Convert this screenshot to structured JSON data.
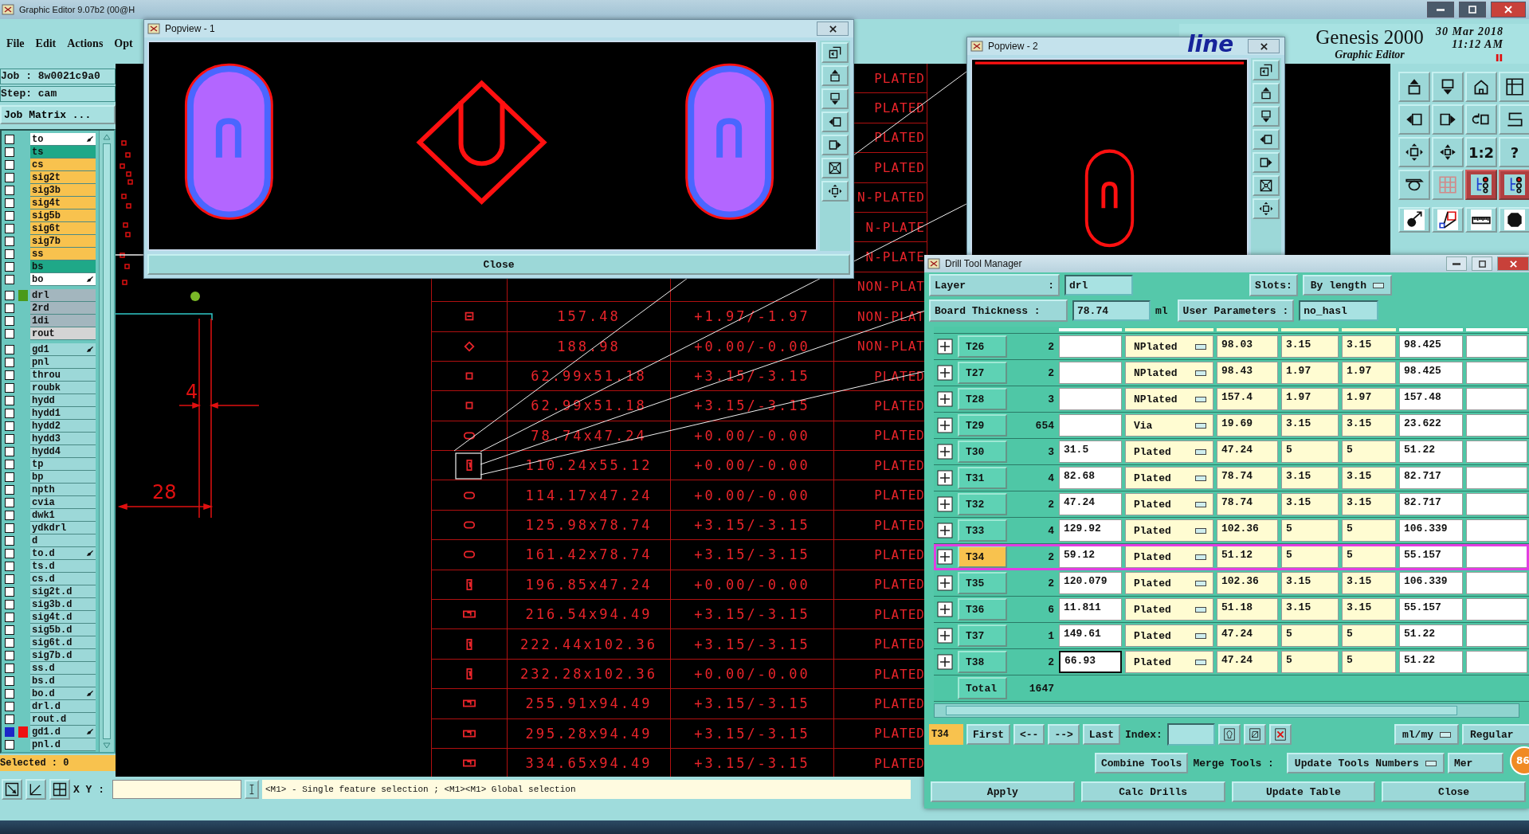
{
  "main_window": {
    "title": "Graphic Editor 9.07b2 (00@H"
  },
  "menu": [
    "File",
    "Edit",
    "Actions",
    "Opt"
  ],
  "header": {
    "logo_fragment": "line",
    "product": "Genesis 2000",
    "subtitle": "Graphic Editor",
    "date": "30 Mar 2018",
    "time": "11:12 AM"
  },
  "job": {
    "job": "Job : 8w0021c9a0",
    "step": "Step: cam",
    "matrix_button": "Job Matrix ..."
  },
  "layer_groups": [
    {
      "layers": [
        {
          "name": "to",
          "color": "#ffffff",
          "pointer": true,
          "selected": false
        },
        {
          "name": "ts",
          "color": "#1fa888",
          "pointer": false,
          "selected": false
        },
        {
          "name": "cs",
          "color": "#f8c24e",
          "pointer": false,
          "selected": false
        },
        {
          "name": "sig2t",
          "color": "#f8c24e",
          "pointer": false,
          "selected": false
        },
        {
          "name": "sig3b",
          "color": "#f8c24e",
          "pointer": false,
          "selected": false
        },
        {
          "name": "sig4t",
          "color": "#f8c24e",
          "pointer": false,
          "selected": false
        },
        {
          "name": "sig5b",
          "color": "#f8c24e",
          "pointer": false,
          "selected": false
        },
        {
          "name": "sig6t",
          "color": "#f8c24e",
          "pointer": false,
          "selected": false
        },
        {
          "name": "sig7b",
          "color": "#f8c24e",
          "pointer": false,
          "selected": false
        },
        {
          "name": "ss",
          "color": "#f8c24e",
          "pointer": false,
          "selected": false
        },
        {
          "name": "bs",
          "color": "#1fa888",
          "pointer": false,
          "selected": false
        },
        {
          "name": "bo",
          "color": "#ffffff",
          "pointer": true,
          "selected": false
        }
      ]
    },
    {
      "layers": [
        {
          "name": "drl",
          "color": "#a3b6be",
          "pointer": false,
          "selected": false,
          "flag": {
            "color": "#4a9a1a"
          }
        },
        {
          "name": "2rd",
          "color": "#a3b6be",
          "pointer": false,
          "selected": false
        },
        {
          "name": "1di",
          "color": "#a3b6be",
          "pointer": false,
          "selected": false
        },
        {
          "name": "rout",
          "color": "#d4d4d4",
          "pointer": false,
          "selected": false
        }
      ]
    },
    {
      "layers": [
        {
          "name": "gd1",
          "color": "#9cd8d8",
          "pointer": true,
          "selected": false
        },
        {
          "name": "pnl",
          "color": "#9cd8d8",
          "pointer": false,
          "selected": false
        },
        {
          "name": "throu",
          "color": "#9cd8d8",
          "pointer": false,
          "selected": false
        },
        {
          "name": "roubk",
          "color": "#9cd8d8",
          "pointer": false,
          "selected": false
        },
        {
          "name": "hydd",
          "color": "#9cd8d8",
          "pointer": false,
          "selected": false
        },
        {
          "name": "hydd1",
          "color": "#9cd8d8",
          "pointer": false,
          "selected": false
        },
        {
          "name": "hydd2",
          "color": "#9cd8d8",
          "pointer": false,
          "selected": false
        },
        {
          "name": "hydd3",
          "color": "#9cd8d8",
          "pointer": false,
          "selected": false
        },
        {
          "name": "hydd4",
          "color": "#9cd8d8",
          "pointer": false,
          "selected": false
        },
        {
          "name": "tp",
          "color": "#9cd8d8",
          "pointer": false,
          "selected": false
        },
        {
          "name": "bp",
          "color": "#9cd8d8",
          "pointer": false,
          "selected": false
        },
        {
          "name": "npth",
          "color": "#9cd8d8",
          "pointer": false,
          "selected": false
        },
        {
          "name": "cvia",
          "color": "#9cd8d8",
          "pointer": false,
          "selected": false
        },
        {
          "name": "dwk1",
          "color": "#9cd8d8",
          "pointer": false,
          "selected": false
        },
        {
          "name": "ydkdrl",
          "color": "#9cd8d8",
          "pointer": false,
          "selected": false
        },
        {
          "name": "d",
          "color": "#9cd8d8",
          "pointer": false,
          "selected": false
        },
        {
          "name": "to.d",
          "color": "#9cd8d8",
          "pointer": true,
          "selected": false
        },
        {
          "name": "ts.d",
          "color": "#9cd8d8",
          "pointer": false,
          "selected": false
        },
        {
          "name": "cs.d",
          "color": "#9cd8d8",
          "pointer": false,
          "selected": false
        },
        {
          "name": "sig2t.d",
          "color": "#9cd8d8",
          "pointer": false,
          "selected": false
        },
        {
          "name": "sig3b.d",
          "color": "#9cd8d8",
          "pointer": false,
          "selected": false
        },
        {
          "name": "sig4t.d",
          "color": "#9cd8d8",
          "pointer": false,
          "selected": false
        },
        {
          "name": "sig5b.d",
          "color": "#9cd8d8",
          "pointer": false,
          "selected": false
        },
        {
          "name": "sig6t.d",
          "color": "#9cd8d8",
          "pointer": false,
          "selected": false
        },
        {
          "name": "sig7b.d",
          "color": "#9cd8d8",
          "pointer": false,
          "selected": false
        },
        {
          "name": "ss.d",
          "color": "#9cd8d8",
          "pointer": false,
          "selected": false
        },
        {
          "name": "bs.d",
          "color": "#9cd8d8",
          "pointer": false,
          "selected": false
        },
        {
          "name": "bo.d",
          "color": "#9cd8d8",
          "pointer": true,
          "selected": false
        },
        {
          "name": "drl.d",
          "color": "#9cd8d8",
          "pointer": false,
          "selected": false
        },
        {
          "name": "rout.d",
          "color": "#9cd8d8",
          "pointer": false,
          "selected": false
        },
        {
          "name": "gd1.d",
          "color": "#9cd8d8",
          "pointer": true,
          "selected": true,
          "flag": {
            "color": "#ee1111"
          }
        },
        {
          "name": "pnl.d",
          "color": "#9cd8d8",
          "pointer": false,
          "selected": false
        }
      ]
    }
  ],
  "selected_count": "Selected : 0",
  "canvas": {
    "dimension_labels": [
      "4",
      "28"
    ],
    "rows": [
      {
        "plating": "PLATED"
      },
      {
        "plating": "PLATED"
      },
      {
        "plating": "PLATED"
      },
      {
        "plating": "PLATED"
      },
      {
        "plating": "N-PLATED"
      },
      {
        "plating": "N-PLATE"
      },
      {
        "plating": "N-PLATE"
      },
      {
        "plating": "NON-PLAT"
      },
      {
        "kind": "square",
        "size": "157.48",
        "tolerance": "+1.97/-1.97",
        "plating": "NON-PLAT"
      },
      {
        "kind": "diamond",
        "size": "188.98",
        "tolerance": "+0.00/-0.00",
        "plating": "NON-PLAT"
      },
      {
        "kind": "dot",
        "size": "62.99x51.18",
        "tolerance": "+3.15/-3.15",
        "plating": "PLATED"
      },
      {
        "kind": "dot",
        "size": "62.99x51.18",
        "tolerance": "+3.15/-3.15",
        "plating": "PLATED"
      },
      {
        "kind": "oval",
        "size": "78.74x47.24",
        "tolerance": "+0.00/-0.00",
        "plating": "PLATED"
      },
      {
        "kind": "slot",
        "size": "110.24x55.12",
        "tolerance": "+0.00/-0.00",
        "plating": "PLATED"
      },
      {
        "kind": "oval",
        "size": "114.17x47.24",
        "tolerance": "+0.00/-0.00",
        "plating": "PLATED"
      },
      {
        "kind": "oval",
        "size": "125.98x78.74",
        "tolerance": "+3.15/-3.15",
        "plating": "PLATED"
      },
      {
        "kind": "oval",
        "size": "161.42x78.74",
        "tolerance": "+3.15/-3.15",
        "plating": "PLATED"
      },
      {
        "kind": "slot",
        "size": "196.85x47.24",
        "tolerance": "+0.00/-0.00",
        "plating": "PLATED"
      },
      {
        "kind": "rect",
        "size": "216.54x94.49",
        "tolerance": "+3.15/-3.15",
        "plating": "PLATED"
      },
      {
        "kind": "slot",
        "size": "222.44x102.36",
        "tolerance": "+3.15/-3.15",
        "plating": "PLATED"
      },
      {
        "kind": "slot",
        "size": "232.28x102.36",
        "tolerance": "+0.00/-0.00",
        "plating": "PLATED"
      },
      {
        "kind": "rect",
        "size": "255.91x94.49",
        "tolerance": "+3.15/-3.15",
        "plating": "PLATED"
      },
      {
        "kind": "rect",
        "size": "295.28x94.49",
        "tolerance": "+3.15/-3.15",
        "plating": "PLATED"
      },
      {
        "kind": "rect",
        "size": "334.65x94.49",
        "tolerance": "+3.15/-3.15",
        "plating": "PLATED"
      }
    ]
  },
  "toolbar": [
    {
      "kind": "up",
      "on": false
    },
    {
      "kind": "down",
      "on": false
    },
    {
      "kind": "home",
      "on": false
    },
    {
      "kind": "frame",
      "on": false
    },
    {
      "kind": "left",
      "on": false
    },
    {
      "kind": "right",
      "on": false
    },
    {
      "kind": "undo",
      "on": false
    },
    {
      "kind": "zigzag",
      "on": false
    },
    {
      "kind": "fit",
      "on": false
    },
    {
      "kind": "center",
      "on": false
    },
    {
      "kind": "label",
      "label": "1:2",
      "on": false
    },
    {
      "kind": "label",
      "label": "?",
      "on": false
    },
    {
      "kind": "tools",
      "on": false
    },
    {
      "kind": "grid",
      "on": false
    },
    {
      "kind": "circuit",
      "on": true
    },
    {
      "kind": "circuit",
      "on": true
    },
    {
      "kind": "probe",
      "on": false
    },
    {
      "kind": "shapes",
      "on": false
    },
    {
      "kind": "ruler",
      "on": false
    },
    {
      "kind": "pad",
      "on": false
    }
  ],
  "popview_1": {
    "title": "Popview - 1",
    "close_button": "Close",
    "tools": [
      {
        "kind": "restore"
      },
      {
        "kind": "up"
      },
      {
        "kind": "down"
      },
      {
        "kind": "left"
      },
      {
        "kind": "right"
      },
      {
        "kind": "shrink"
      },
      {
        "kind": "fit"
      }
    ]
  },
  "popview_2": {
    "title": "Popview - 2",
    "tools": [
      {
        "kind": "restore"
      },
      {
        "kind": "up"
      },
      {
        "kind": "down"
      },
      {
        "kind": "left"
      },
      {
        "kind": "right"
      },
      {
        "kind": "shrink"
      },
      {
        "kind": "fit"
      }
    ]
  },
  "drill_manager": {
    "title": "Drill Tool Manager",
    "layer": {
      "label": "Layer",
      "separator": ":",
      "value": "drl"
    },
    "slots": {
      "label": "Slots:",
      "value": "By length"
    },
    "thickness": {
      "label": "Board Thickness :",
      "value": "78.74",
      "unit": "ml"
    },
    "user_parameters": {
      "label": "User Parameters :",
      "value": "no_hasl"
    },
    "rows": [
      {
        "tool": "T26",
        "count": "2",
        "type": "NPlated",
        "col_5": "98.03",
        "col_6": "3.15",
        "col_7": "3.15",
        "col_8": "98.425",
        "selected": false,
        "focused": false
      },
      {
        "tool": "T27",
        "count": "2",
        "type": "NPlated",
        "col_5": "98.43",
        "col_6": "1.97",
        "col_7": "1.97",
        "col_8": "98.425",
        "selected": false,
        "focused": false
      },
      {
        "tool": "T28",
        "count": "3",
        "type": "NPlated",
        "col_5": "157.4",
        "col_6": "1.97",
        "col_7": "1.97",
        "col_8": "157.48",
        "selected": false,
        "focused": false
      },
      {
        "tool": "T29",
        "count": "654",
        "type": "Via",
        "col_5": "19.69",
        "col_6": "3.15",
        "col_7": "3.15",
        "col_8": "23.622",
        "selected": false,
        "focused": false
      },
      {
        "tool": "T30",
        "count": "3",
        "col_3": "31.5",
        "type": "Plated",
        "col_5": "47.24",
        "col_6": "5",
        "col_7": "5",
        "col_8": "51.22",
        "selected": false,
        "focused": false
      },
      {
        "tool": "T31",
        "count": "4",
        "col_3": "82.68",
        "type": "Plated",
        "col_5": "78.74",
        "col_6": "3.15",
        "col_7": "3.15",
        "col_8": "82.717",
        "selected": false,
        "focused": false
      },
      {
        "tool": "T32",
        "count": "2",
        "col_3": "47.24",
        "type": "Plated",
        "col_5": "78.74",
        "col_6": "3.15",
        "col_7": "3.15",
        "col_8": "82.717",
        "selected": false,
        "focused": false
      },
      {
        "tool": "T33",
        "count": "4",
        "col_3": "129.92",
        "type": "Plated",
        "col_5": "102.36",
        "col_6": "5",
        "col_7": "5",
        "col_8": "106.339",
        "selected": false,
        "focused": false
      },
      {
        "tool": "T34",
        "count": "2",
        "col_3": "59.12",
        "type": "Plated",
        "col_5": "51.12",
        "col_6": "5",
        "col_7": "5",
        "col_8": "55.157",
        "selected": true,
        "focused": false
      },
      {
        "tool": "T35",
        "count": "2",
        "col_3": "120.079",
        "type": "Plated",
        "col_5": "102.36",
        "col_6": "3.15",
        "col_7": "3.15",
        "col_8": "106.339",
        "selected": false,
        "focused": false
      },
      {
        "tool": "T36",
        "count": "6",
        "col_3": "11.811",
        "type": "Plated",
        "col_5": "51.18",
        "col_6": "3.15",
        "col_7": "3.15",
        "col_8": "55.157",
        "selected": false,
        "focused": false
      },
      {
        "tool": "T37",
        "count": "1",
        "col_3": "149.61",
        "type": "Plated",
        "col_5": "47.24",
        "col_6": "5",
        "col_7": "5",
        "col_8": "51.22",
        "selected": false,
        "focused": false
      },
      {
        "tool": "T38",
        "count": "2",
        "col_3": "66.93",
        "type": "Plated",
        "col_5": "47.24",
        "col_6": "5",
        "col_7": "5",
        "col_8": "51.22",
        "selected": false,
        "focused": true
      }
    ],
    "total": {
      "label": "Total",
      "count": "1647"
    },
    "current_tool": "T34",
    "nav_buttons": [
      "First",
      "<--",
      "-->",
      "Last"
    ],
    "index_label": "Index:",
    "units": "ml/my",
    "mode": "Regular",
    "combine_button": "Combine Tools",
    "merge_label": "Merge Tools :",
    "merge_value": "Update Tools Numbers",
    "cut_button": "Mer",
    "badge": "86",
    "actions": [
      "Apply",
      "Calc Drills",
      "Update Table",
      "Close"
    ]
  },
  "status_bar": {
    "xy_label": "X Y :",
    "message": "<M1> - Single feature selection ; <M1><M1> Global selection"
  }
}
